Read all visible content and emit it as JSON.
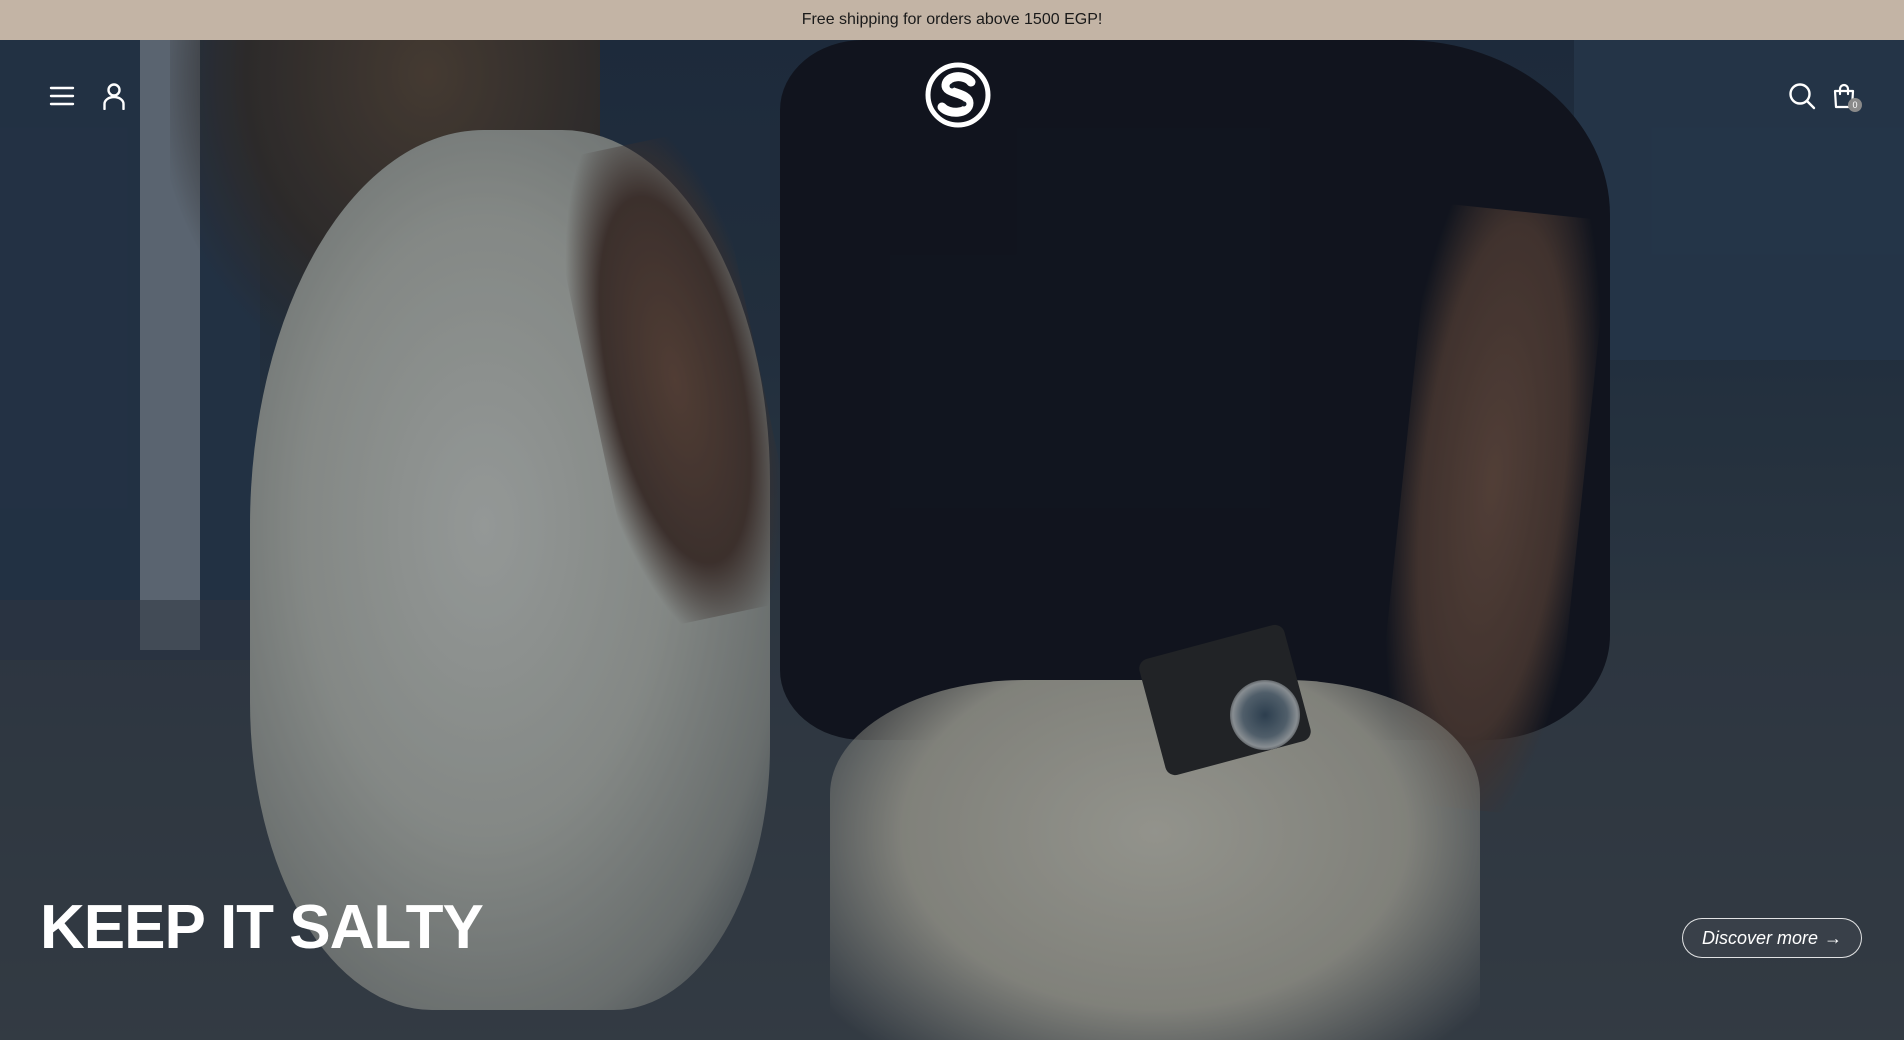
{
  "announcement": {
    "text": "Free shipping for orders above 1500 EGP!"
  },
  "header": {
    "menu_icon": "hamburger-menu-icon",
    "account_icon": "user-account-icon",
    "logo_icon": "salty-s-logo",
    "search_icon": "search-icon",
    "cart_icon": "shopping-bag-icon",
    "cart_count": "0"
  },
  "hero": {
    "title": "KEEP IT SALTY",
    "cta_label": "Discover more",
    "cta_arrow": "→"
  },
  "colors": {
    "announcement_bg": "#c3b4a5",
    "text_on_hero": "#ffffff"
  }
}
